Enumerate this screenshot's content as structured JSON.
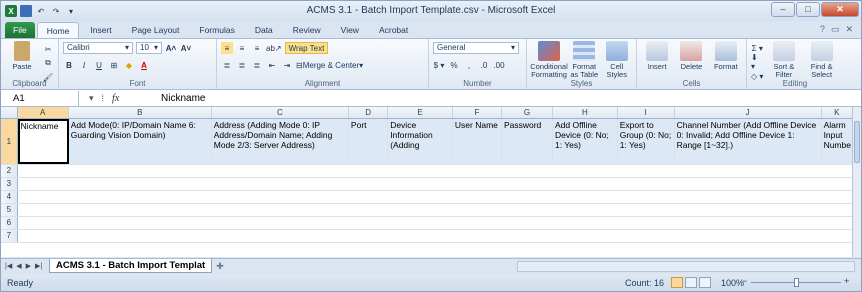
{
  "window": {
    "title": "ACMS 3.1 - Batch Import Template.csv - Microsoft Excel"
  },
  "ribbon_tabs": [
    "File",
    "Home",
    "Insert",
    "Page Layout",
    "Formulas",
    "Data",
    "Review",
    "View",
    "Acrobat"
  ],
  "ribbon": {
    "clipboard": {
      "label": "Clipboard",
      "paste": "Paste"
    },
    "font": {
      "label": "Font",
      "name": "Calibri",
      "size": "10"
    },
    "alignment": {
      "label": "Alignment",
      "wrap_text": "Wrap Text",
      "merge": "Merge & Center"
    },
    "number": {
      "label": "Number",
      "format": "General"
    },
    "styles": {
      "label": "Styles",
      "conditional": "Conditional Formatting",
      "format_table": "Format as Table",
      "cell_styles": "Cell Styles"
    },
    "cells": {
      "label": "Cells",
      "insert": "Insert",
      "delete": "Delete",
      "format": "Format"
    },
    "editing": {
      "label": "Editing",
      "sort": "Sort & Filter",
      "find": "Find & Select"
    }
  },
  "formula_bar": {
    "name_box": "A1",
    "fx": "fx",
    "value": "Nickname"
  },
  "columns": [
    "A",
    "B",
    "C",
    "D",
    "E",
    "F",
    "G",
    "H",
    "I",
    "J",
    "K"
  ],
  "header_row": [
    "Nickname",
    "Add Mode(0: IP/Domain Name 6: Guarding Vision Domain)",
    "Address (Adding Mode 0: IP Address/Domain Name; Adding Mode 2/3: Server Address)",
    "Port",
    "Device Information (Adding",
    "User Name",
    "Password",
    "Add Offline Device (0: No; 1: Yes)",
    "Export to Group (0: No; 1: Yes)",
    "Channel Number (Add Offline Device 0: Invalid; Add Offline Device 1: Range [1~32].)",
    "Alarm Input Numbe"
  ],
  "row_numbers": [
    "1",
    "2",
    "3",
    "4",
    "5",
    "6",
    "7"
  ],
  "sheet_tab": "ACMS 3.1 - Batch Import Templat",
  "status": {
    "ready": "Ready",
    "count": "Count: 16",
    "zoom": "100%"
  }
}
